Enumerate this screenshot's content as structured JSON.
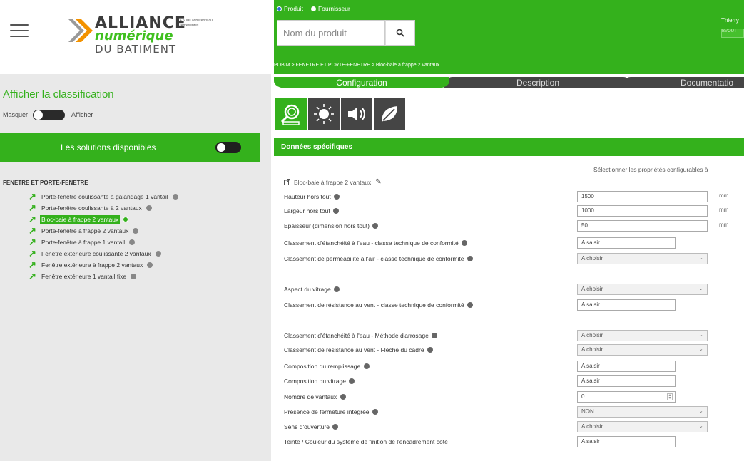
{
  "logo": {
    "line1": "ALLIANCE",
    "line2": "numérique",
    "line3": "DU BATIMENT",
    "note": "+ 6000 adhérents ou représentés"
  },
  "sidebar": {
    "classification_title": "Afficher la classification",
    "toggle_left": "Masquer",
    "toggle_right": "Afficher",
    "solutions_label": "Les solutions disponibles",
    "tree_root": "FENETRE ET PORTE-FENETRE",
    "items": [
      {
        "label": "Porte-fenêtre coulissante à galandage 1 vantail"
      },
      {
        "label": "Porte-fenêtre coulissante à 2 vantaux"
      },
      {
        "label": "Bloc-baie à frappe 2 vantaux"
      },
      {
        "label": "Porte-fenêtre à frappe 2 vantaux"
      },
      {
        "label": "Porte-fenêtre à frappe 1 vantail"
      },
      {
        "label": "Fenêtre extérieure coulissante 2 vantaux"
      },
      {
        "label": "Fenêtre extérieure à frappe 2 vantaux"
      },
      {
        "label": "Fenêtre extérieure 1 vantail fixe"
      }
    ],
    "selected_index": 2
  },
  "search": {
    "radio_product": "Produit",
    "radio_supplier": "Fournisseur",
    "placeholder": "Nom du produit"
  },
  "user": {
    "name": "Thierry",
    "button": "BVOUT"
  },
  "breadcrumb": "POBIM > FENETRE ET PORTE-FENETRE > Bloc-baie à frappe 2 vantaux",
  "tabs": {
    "configuration": "Configuration",
    "description": "Description",
    "documentation": "Documentatio"
  },
  "icons": [
    "search-config-icon",
    "sun-icon",
    "sound-icon",
    "leaf-icon"
  ],
  "section": {
    "title": "Données spécifiques",
    "select_configurable": "Sélectionner les propriétés configurables à",
    "product_name": "Bloc-baie à frappe 2 vantaux"
  },
  "properties": [
    {
      "label": "Hauteur hors tout",
      "type": "input",
      "value": "1500",
      "unit": "mm"
    },
    {
      "label": "Largeur hors tout",
      "type": "input",
      "value": "1000",
      "unit": "mm"
    },
    {
      "label": "Epaisseur (dimension hors tout)",
      "type": "input",
      "value": "50",
      "unit": "mm"
    },
    {
      "label": "Classement d'étanchéité à l'eau - classe technique de conformité",
      "type": "text",
      "value": "A saisir"
    },
    {
      "label": "Classement de perméabilité à l'air - classe technique de conformité",
      "type": "select",
      "value": "A choisir"
    },
    {
      "label": "Aspect du vitrage",
      "type": "select",
      "value": "A choisir"
    },
    {
      "label": "Classement de résistance au vent - classe technique de conformité",
      "type": "text",
      "value": "A saisir"
    },
    {
      "label": "Classement d'étanchéité à l'eau - Méthode d'arrosage",
      "type": "select",
      "value": "A choisir"
    },
    {
      "label": "Classement de résistance au vent - Flèche du cadre",
      "type": "select",
      "value": "A choisir"
    },
    {
      "label": "Composition du remplissage",
      "type": "text",
      "value": "A saisir"
    },
    {
      "label": "Composition du vitrage",
      "type": "text",
      "value": "A saisir"
    },
    {
      "label": "Nombre de vantaux",
      "type": "stepper",
      "value": "0"
    },
    {
      "label": "Présence de fermeture intégrée",
      "type": "select",
      "value": "NON"
    },
    {
      "label": "Sens d'ouverture",
      "type": "select",
      "value": "A choisir"
    },
    {
      "label": "Teinte / Couleur du système de finition de l'encadrement coté",
      "type": "text",
      "value": "A saisir"
    }
  ],
  "colors": {
    "brand_green": "#34b11c",
    "dark_tab": "#454545",
    "sidebar_bg": "#e9e9e9"
  }
}
